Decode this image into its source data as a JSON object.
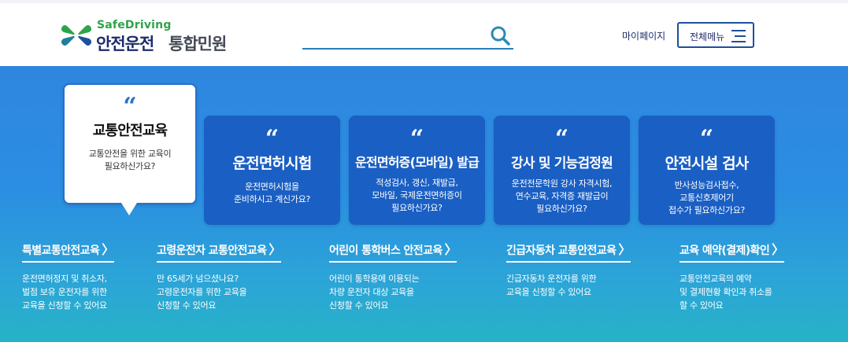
{
  "header": {
    "logo_en": "SafeDriving",
    "logo_ko_main": "안전운전",
    "logo_ko_sub": "통합민원",
    "search_placeholder": "",
    "mypage_label": "마이페이지",
    "allmenu_label": "전체메뉴"
  },
  "cards": [
    {
      "quote": "“",
      "title": "교통안전교육",
      "desc": [
        "교통안전을 위한 교육이",
        "필요하신가요?"
      ]
    },
    {
      "quote": "“",
      "title": "운전면허시험",
      "desc": [
        "운전면허시험을",
        "준비하시고 계신가요?"
      ]
    },
    {
      "quote": "“",
      "title": "운전면허증(모바일) 발급",
      "desc": [
        "적성검사, 갱신, 재발급,",
        "모바일, 국제운전면허증이",
        "필요하신가요?"
      ]
    },
    {
      "quote": "“",
      "title": "강사 및 기능검정원",
      "desc": [
        "운전전문학원 강사 자격시험,",
        "연수교육, 자격증 재발급이",
        "필요하신가요?"
      ]
    },
    {
      "quote": "“",
      "title": "안전시설 검사",
      "desc": [
        "반사성능검사접수,",
        "교통신호제어기",
        "접수가 필요하신가요?"
      ]
    }
  ],
  "links": [
    {
      "title": "특별교통안전교육",
      "arrow": "〉",
      "desc": [
        "운전면허정지 및 취소자,",
        "벌점 보유 운전자를 위한",
        "교육을 신청할 수 있어요"
      ]
    },
    {
      "title": "고령운전자 교통안전교육",
      "arrow": "〉",
      "desc": [
        "만 65세가 넘으셨나요?",
        "고령운전자를 위한 교육을",
        "신청할 수 있어요"
      ]
    },
    {
      "title": "어린이 통학버스 안전교육",
      "arrow": "〉",
      "desc": [
        "어린이 통학용에 이용되는",
        "차량 운전자 대상 교육을",
        "신청할 수 있어요"
      ]
    },
    {
      "title": "긴급자동차 교통안전교육",
      "arrow": "〉",
      "desc": [
        "긴급자동차 운전자를 위한",
        "교육을 신청할 수 있어요"
      ]
    },
    {
      "title": "교육 예약(결제)확인",
      "arrow": "〉",
      "desc": [
        "교통안전교육의 예약",
        "및 결제현황 확인과 취소를",
        "할 수 있어요"
      ]
    }
  ],
  "colors": {
    "brand_navy": "#1d2b6b",
    "brand_green": "#2fa34a",
    "card_blue": "#1a5fc3",
    "hero_top": "#2f86df",
    "hero_bottom": "#26b3c6"
  },
  "icons": {
    "search": "search-icon",
    "menu": "hamburger-icon",
    "logo": "clover-logo-icon"
  }
}
